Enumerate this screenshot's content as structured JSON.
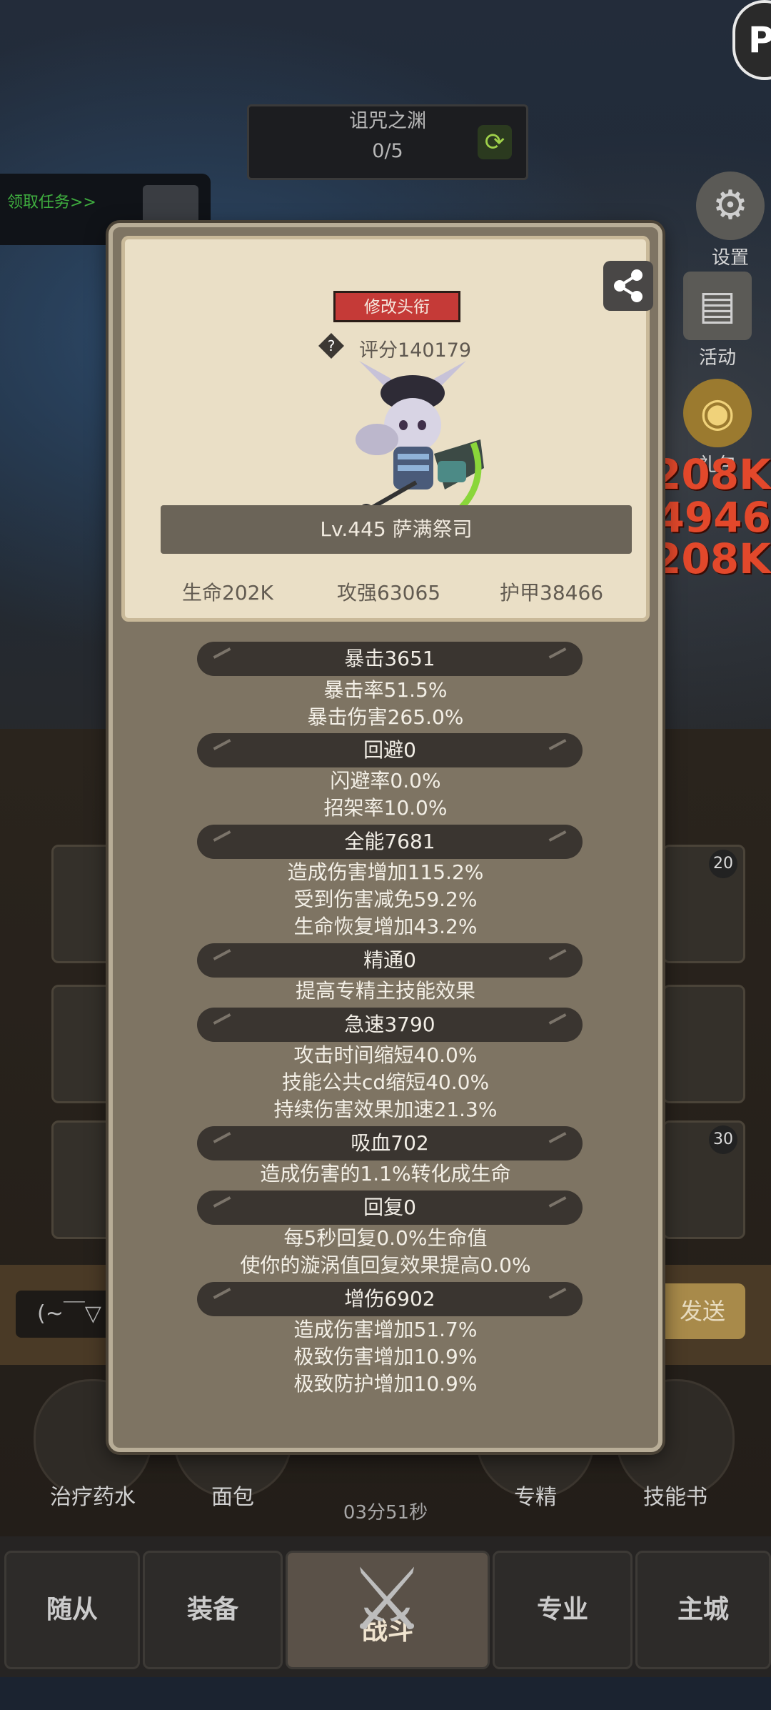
{
  "background": {
    "quest": {
      "title": "诅咒之渊",
      "progress": "0/5"
    },
    "task_banner": "领取任务>>",
    "side_icons": [
      {
        "label": "设置",
        "icon": "gear-icon"
      },
      {
        "label": "活动",
        "icon": "scroll-icon"
      },
      {
        "label": "礼包",
        "icon": "gift-icon"
      }
    ],
    "damage_numbers": [
      "208K",
      "4946",
      "208K"
    ],
    "slot_badges": [
      "20",
      "30"
    ],
    "chat": {
      "input": "(~￣▽",
      "send": "发送"
    },
    "items": [
      {
        "label": "治疗药水"
      },
      {
        "label": "面包"
      },
      {
        "label": "专精"
      },
      {
        "label": "技能书"
      }
    ],
    "timer": "03分51秒",
    "nav": [
      "随从",
      "装备",
      "战斗",
      "专业",
      "主城"
    ]
  },
  "profile": {
    "title_button": "修改头衔",
    "score": "评分140179",
    "name": "Lv.445 萨满祭司",
    "stats": {
      "hp": "生命202K",
      "attack": "攻强63065",
      "armor": "护甲38466"
    }
  },
  "sections": [
    {
      "header": "暴击3651",
      "lines": [
        "暴击率51.5%",
        "暴击伤害265.0%"
      ]
    },
    {
      "header": "回避0",
      "lines": [
        "闪避率0.0%",
        "招架率10.0%"
      ]
    },
    {
      "header": "全能7681",
      "lines": [
        "造成伤害增加115.2%",
        "受到伤害减免59.2%",
        "生命恢复增加43.2%"
      ]
    },
    {
      "header": "精通0",
      "lines": [
        "提高专精主技能效果"
      ]
    },
    {
      "header": "急速3790",
      "lines": [
        "攻击时间缩短40.0%",
        "技能公共cd缩短40.0%",
        "持续伤害效果加速21.3%"
      ]
    },
    {
      "header": "吸血702",
      "lines": [
        "造成伤害的1.1%转化成生命"
      ]
    },
    {
      "header": "回复0",
      "lines": [
        "每5秒回复0.0%生命值",
        "使你的漩涡值回复效果提高0.0%"
      ]
    },
    {
      "header": "增伤6902",
      "lines": [
        "造成伤害增加51.7%",
        "极致伤害增加10.9%",
        "极致防护增加10.9%"
      ]
    }
  ]
}
